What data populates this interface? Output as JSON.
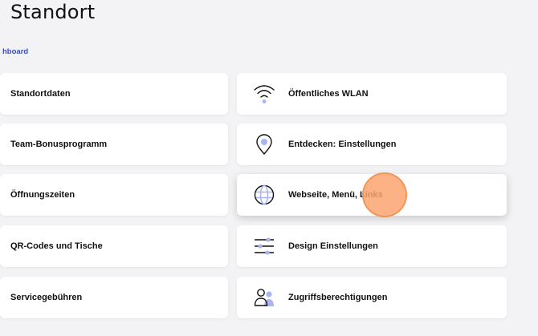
{
  "header": {
    "title": "Standort",
    "breadcrumb": "hboard"
  },
  "colors": {
    "accent": "#3b4cc0",
    "icon_fill": "#a9b4f2",
    "card_bg": "#ffffff",
    "page_bg": "#f3f3f5",
    "click_indicator": "#fca56e"
  },
  "left_cards": [
    {
      "label": "Standortdaten"
    },
    {
      "label": "Team-Bonusprogramm"
    },
    {
      "label": "Öffnungszeiten"
    },
    {
      "label": "QR-Codes und Tische"
    },
    {
      "label": "Servicegebühren"
    }
  ],
  "right_cards": [
    {
      "label": "Öffentliches WLAN",
      "icon": "wifi-icon"
    },
    {
      "label": "Entdecken: Einstellungen",
      "icon": "map-pin-icon"
    },
    {
      "label": "Webseite, Menü, Links",
      "icon": "globe-icon"
    },
    {
      "label": "Design Einstellungen",
      "icon": "sliders-icon"
    },
    {
      "label": "Zugriffsberechtigungen",
      "icon": "users-icon"
    }
  ]
}
